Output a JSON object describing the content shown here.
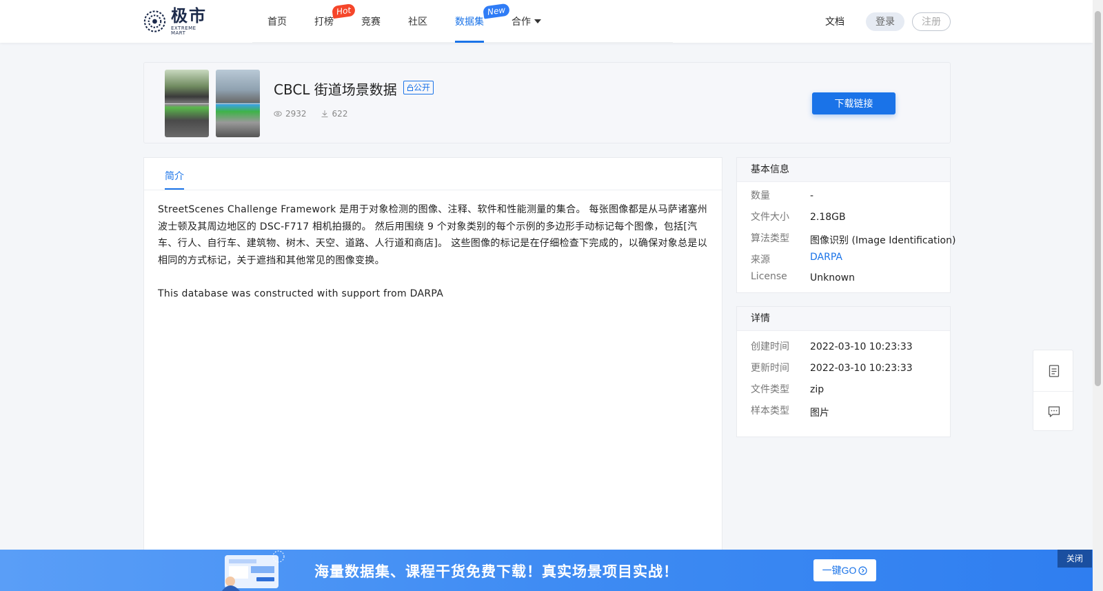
{
  "header": {
    "logo_cn": "极市",
    "logo_en": "EXTREME MART",
    "nav": [
      {
        "label": "首页"
      },
      {
        "label": "打榜",
        "badge": "Hot"
      },
      {
        "label": "竞赛"
      },
      {
        "label": "社区"
      },
      {
        "label": "数据集",
        "badge": "New"
      },
      {
        "label": "合作"
      }
    ],
    "docs": "文档",
    "login": "登录",
    "register": "注册"
  },
  "dataset": {
    "title": "CBCL 街道场景数据",
    "visibility": "公开",
    "views": "2932",
    "downloads": "622",
    "download_button": "下载链接"
  },
  "tabs": {
    "intro": "简介"
  },
  "description": {
    "p1": "StreetScenes Challenge Framework 是用于对象检测的图像、注释、软件和性能测量的集合。 每张图像都是从马萨诸塞州波士顿及其周边地区的 DSC-F717 相机拍摄的。 然后用围绕 9 个对象类别的每个示例的多边形手动标记每个图像，包括[汽车、行人、自行车、建筑物、树木、天空、道路、人行道和商店]。 这些图像的标记是在仔细检查下完成的，以确保对象总是以相同的方式标记，关于遮挡和其他常见的图像变换。",
    "p2": "This database was constructed with support from DARPA"
  },
  "basic_info": {
    "heading": "基本信息",
    "rows": [
      {
        "key": "数量",
        "value": "-"
      },
      {
        "key": "文件大小",
        "value": "2.18GB"
      },
      {
        "key": "算法类型",
        "value": "图像识别 (Image Identification)"
      },
      {
        "key": "来源",
        "value": "DARPA"
      },
      {
        "key": "License",
        "value": "Unknown"
      }
    ]
  },
  "details": {
    "heading": "详情",
    "rows": [
      {
        "key": "创建时间",
        "value": "2022-03-10 10:23:33"
      },
      {
        "key": "更新时间",
        "value": "2022-03-10 10:23:33"
      },
      {
        "key": "文件类型",
        "value": "zip"
      },
      {
        "key": "样本类型",
        "value": "图片"
      }
    ]
  },
  "banner": {
    "text": "海量数据集、课程干货免费下载！真实场景项目实战！",
    "go_button": "一键GO",
    "close": "关闭"
  },
  "colors": {
    "accent": "#1a73e8",
    "hot": "#f5462a",
    "banner": "#3f8cf3"
  }
}
